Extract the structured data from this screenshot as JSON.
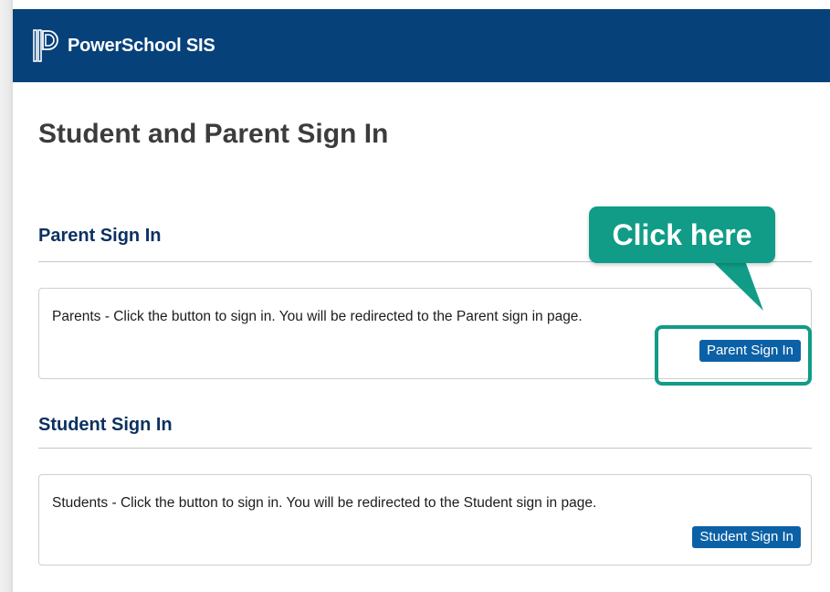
{
  "header": {
    "app_name": "PowerSchool SIS",
    "logo_icon": "powerschool-logo",
    "background_color": "#06417a"
  },
  "page_title": "Student and Parent Sign In",
  "parent_section": {
    "title": "Parent Sign In",
    "description": "Parents - Click the button to sign in. You will be redirected to the Parent sign in page.",
    "button_label": "Parent Sign In"
  },
  "student_section": {
    "title": "Student Sign In",
    "description": "Students - Click the button to sign in. You will be redirected to the Student sign in page.",
    "button_label": "Student Sign In"
  },
  "annotation": {
    "callout_text": "Click here",
    "accent_color": "#109c87"
  },
  "colors": {
    "button": "#0c61a6",
    "section_title": "#0b3161"
  }
}
